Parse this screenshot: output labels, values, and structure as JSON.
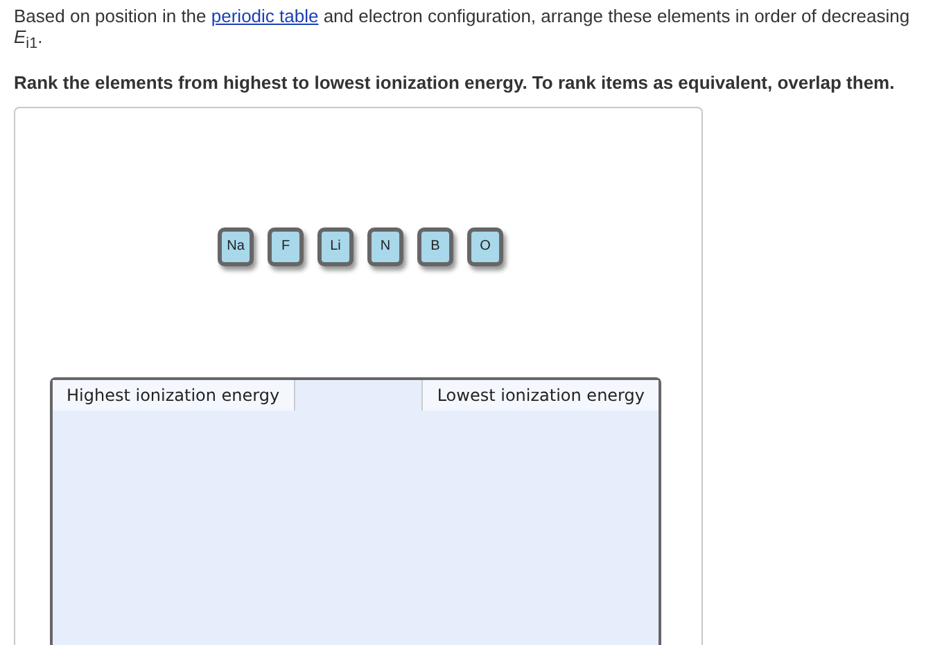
{
  "intro": {
    "before": "Based on position in the ",
    "link": "periodic table",
    "after": " and electron configuration, arrange these elements in order of decreasing *E*$_{i1}$."
  },
  "instruction": "Rank the elements from highest to lowest ionization energy. To rank items as equivalent, overlap them.",
  "tiles": [
    "Na",
    "F",
    "Li",
    "N",
    "B",
    "O"
  ],
  "ranking": {
    "highest_label": "Highest ionization energy",
    "lowest_label": "Lowest ionization energy"
  }
}
